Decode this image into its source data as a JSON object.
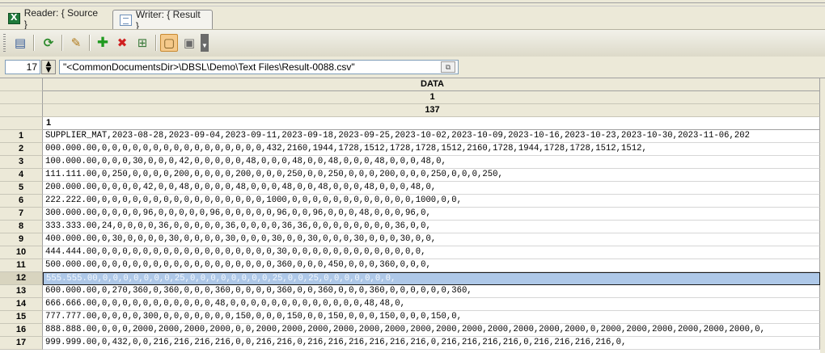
{
  "tabs": [
    {
      "label": "Reader: { Source }",
      "icon": "excel-icon",
      "active": false
    },
    {
      "label": "Writer: { Result }",
      "icon": "document-icon",
      "active": true
    }
  ],
  "toolbar": {
    "buttons": [
      {
        "name": "properties-icon",
        "glyph": "▤"
      },
      {
        "name": "refresh-icon",
        "glyph": "⟳"
      },
      {
        "name": "edit-icon",
        "glyph": "✎"
      },
      {
        "name": "add-icon",
        "glyph": "✚"
      },
      {
        "name": "delete-icon",
        "glyph": "✖"
      },
      {
        "name": "structure-icon",
        "glyph": "⊞"
      },
      {
        "name": "view-grid-icon",
        "glyph": "▢"
      },
      {
        "name": "view-options-icon",
        "glyph": "▣"
      }
    ],
    "dropdown_arrow": "▼"
  },
  "path_row": {
    "row_number": "17",
    "spin_up": "▲",
    "spin_down": "▼",
    "file_path": "\"<CommonDocumentsDir>\\DBSL\\Demo\\Text Files\\Result-0088.csv\"",
    "browse_glyph": "⧉"
  },
  "grid": {
    "header_rows": [
      "DATA",
      "1",
      "137"
    ],
    "column_number": "1",
    "selected_row": "12",
    "rows": [
      {
        "n": "1",
        "v": "SUPPLIER_MAT,2023-08-28,2023-09-04,2023-09-11,2023-09-18,2023-09-25,2023-10-02,2023-10-09,2023-10-16,2023-10-23,2023-10-30,2023-11-06,202"
      },
      {
        "n": "2",
        "v": "000.000.00,0,0,0,0,0,0,0,0,0,0,0,0,0,0,0,0,432,2160,1944,1728,1512,1728,1728,1512,2160,1728,1944,1728,1728,1512,1512,"
      },
      {
        "n": "3",
        "v": "100.000.00,0,0,0,30,0,0,0,42,0,0,0,0,0,48,0,0,0,48,0,0,48,0,0,0,48,0,0,0,48,0,"
      },
      {
        "n": "4",
        "v": "111.111.00,0,250,0,0,0,0,200,0,0,0,0,200,0,0,0,250,0,0,250,0,0,0,200,0,0,0,250,0,0,0,250,"
      },
      {
        "n": "5",
        "v": "200.000.00,0,0,0,0,42,0,0,48,0,0,0,0,48,0,0,0,48,0,0,48,0,0,0,48,0,0,0,48,0,"
      },
      {
        "n": "6",
        "v": "222.222.00,0,0,0,0,0,0,0,0,0,0,0,0,0,0,0,0,1000,0,0,0,0,0,0,0,0,0,0,0,0,1000,0,0,"
      },
      {
        "n": "7",
        "v": "300.000.00,0,0,0,0,96,0,0,0,0,0,96,0,0,0,0,0,96,0,0,96,0,0,0,48,0,0,0,96,0,"
      },
      {
        "n": "8",
        "v": "333.333.00,24,0,0,0,0,36,0,0,0,0,0,36,0,0,0,0,36,36,0,0,0,0,0,0,0,0,36,0,0,"
      },
      {
        "n": "9",
        "v": "400.000.00,0,30,0,0,0,0,30,0,0,0,0,30,0,0,0,30,0,0,30,0,0,0,30,0,0,0,30,0,0,"
      },
      {
        "n": "10",
        "v": "444.444.00,0,0,0,0,0,0,0,0,0,0,0,0,0,0,0,0,0,30,0,0,0,0,0,0,0,0,0,0,0,0,0,"
      },
      {
        "n": "11",
        "v": "500.000.00,0,0,0,0,0,0,0,0,0,0,0,0,0,0,0,0,0,360,0,0,0,450,0,0,0,360,0,0,0,"
      },
      {
        "n": "12",
        "v": "555.555.00,0,0,0,0,0,0,0,25,0,0,0,0,0,0,0,0,25,0,0,25,0,0,0,0,0,0,0,"
      },
      {
        "n": "13",
        "v": "600.000.00,0,270,360,0,360,0,0,0,360,0,0,0,0,360,0,0,360,0,0,0,360,0,0,0,0,0,0,360,"
      },
      {
        "n": "14",
        "v": "666.666.00,0,0,0,0,0,0,0,0,0,0,0,48,0,0,0,0,0,0,0,0,0,0,0,0,0,48,48,0,"
      },
      {
        "n": "15",
        "v": "777.777.00,0,0,0,0,300,0,0,0,0,0,0,0,150,0,0,0,150,0,0,150,0,0,0,150,0,0,0,150,0,"
      },
      {
        "n": "16",
        "v": "888.888.00,0,0,0,2000,2000,2000,2000,0,0,2000,2000,2000,2000,2000,2000,2000,2000,2000,2000,2000,2000,2000,0,2000,2000,2000,2000,2000,2000,0,"
      },
      {
        "n": "17",
        "v": "999.999.00,0,432,0,0,216,216,216,216,0,0,216,216,0,216,216,216,216,216,216,0,216,216,216,216,0,216,216,216,216,0,"
      }
    ]
  }
}
